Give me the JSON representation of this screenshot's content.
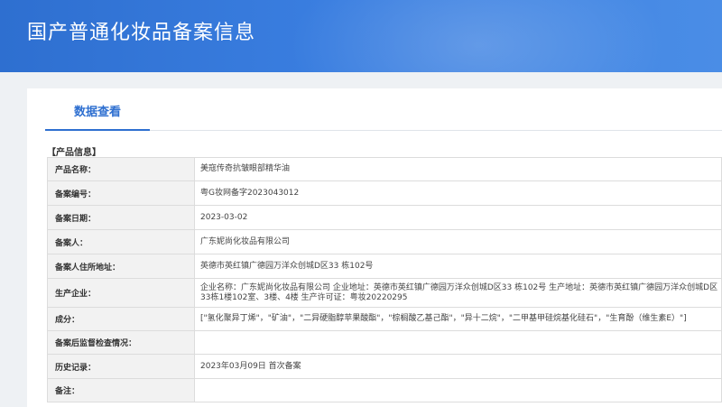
{
  "header": {
    "title": "国产普通化妆品备案信息"
  },
  "tabs": [
    {
      "label": "数据查看"
    }
  ],
  "section": {
    "label": "【产品信息】"
  },
  "rows": [
    {
      "label": "产品名称：",
      "value": "美寇传奇抗皱眼部精华油"
    },
    {
      "label": "备案编号：",
      "value": "粤G妆网备字2023043012"
    },
    {
      "label": "备案日期：",
      "value": "2023-03-02"
    },
    {
      "label": "备案人：",
      "value": "广东妮尚化妆品有限公司"
    },
    {
      "label": "备案人住所地址：",
      "value": "英德市英红镇广德园万洋众创城D区33 栋102号"
    },
    {
      "label": "生产企业：",
      "value": "企业名称：广东妮尚化妆品有限公司 企业地址：英德市英红镇广德园万洋众创城D区33 栋102号 生产地址：英德市英红镇广德园万洋众创城D区33栋1楼102室、3楼、4楼 生产许可证：粤妆20220295"
    },
    {
      "label": "成分：",
      "value": "[\"氢化聚异丁烯\"，\"矿油\"，\"二异硬脂醇苹果酸酯\"，\"棕榈酸乙基己酯\"，\"异十二烷\"，\"二甲基甲硅烷基化硅石\"，\"生育酚（维生素E）\"]"
    },
    {
      "label": "备案后监督检查情况：",
      "value": ""
    },
    {
      "label": "历史记录：",
      "value": "2023年03月09日 首次备案"
    },
    {
      "label": "备注：",
      "value": ""
    }
  ]
}
